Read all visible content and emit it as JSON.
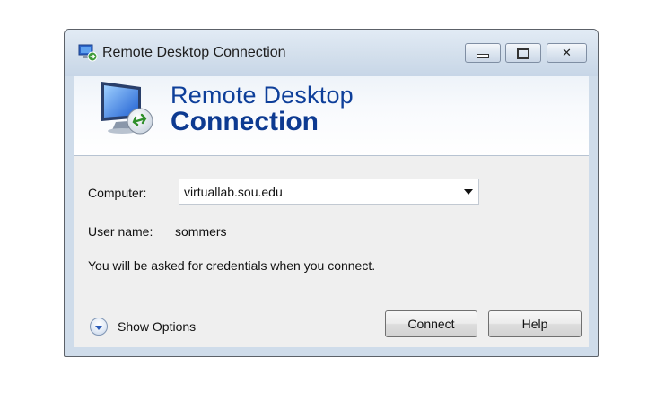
{
  "window": {
    "title": "Remote Desktop Connection",
    "controls": {
      "minimize_icon": "minimize-icon",
      "maximize_icon": "maximize-icon",
      "close_glyph": "✕"
    }
  },
  "banner": {
    "line1": "Remote Desktop",
    "line2": "Connection"
  },
  "form": {
    "computer_label": "Computer:",
    "computer_value": "virtuallab.sou.edu",
    "user_label": "User name:",
    "user_value": "sommers",
    "note": "You will be asked for credentials when you connect."
  },
  "footer": {
    "show_options_label": "Show Options",
    "connect_label": "Connect",
    "help_label": "Help"
  },
  "colors": {
    "banner_text": "#0e3f9a",
    "frame": "#cfdcea",
    "content_bg": "#efefef"
  }
}
